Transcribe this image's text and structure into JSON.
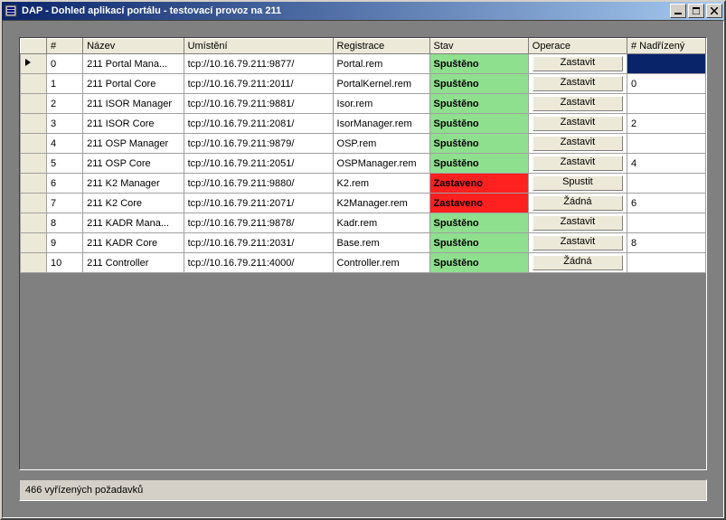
{
  "window": {
    "title": "DAP - Dohled aplikací portálu - testovací provoz na 211"
  },
  "headers": {
    "index": "#",
    "name": "Název",
    "location": "Umístění",
    "registration": "Registrace",
    "state": "Stav",
    "operation": "Operace",
    "supervisor": "# Nadřízený"
  },
  "state_labels": {
    "running": "Spuštěno",
    "stopped": "Zastaveno"
  },
  "rows": [
    {
      "idx": "0",
      "name": "211 Portal Mana...",
      "loc": "tcp://10.16.79.211:9877/",
      "reg": "Portal.rem",
      "state": "running",
      "op": "Zastavit",
      "sup": "",
      "selected": true
    },
    {
      "idx": "1",
      "name": "211 Portal Core",
      "loc": "tcp://10.16.79.211:2011/",
      "reg": "PortalKernel.rem",
      "state": "running",
      "op": "Zastavit",
      "sup": "0"
    },
    {
      "idx": "2",
      "name": "211 ISOR Manager",
      "loc": "tcp://10.16.79.211:9881/",
      "reg": "Isor.rem",
      "state": "running",
      "op": "Zastavit",
      "sup": ""
    },
    {
      "idx": "3",
      "name": "211 ISOR Core",
      "loc": "tcp://10.16.79.211:2081/",
      "reg": "IsorManager.rem",
      "state": "running",
      "op": "Zastavit",
      "sup": "2"
    },
    {
      "idx": "4",
      "name": "211 OSP Manager",
      "loc": "tcp://10.16.79.211:9879/",
      "reg": "OSP.rem",
      "state": "running",
      "op": "Zastavit",
      "sup": ""
    },
    {
      "idx": "5",
      "name": "211 OSP Core",
      "loc": "tcp://10.16.79.211:2051/",
      "reg": "OSPManager.rem",
      "state": "running",
      "op": "Zastavit",
      "sup": "4"
    },
    {
      "idx": "6",
      "name": "211 K2 Manager",
      "loc": "tcp://10.16.79.211:9880/",
      "reg": "K2.rem",
      "state": "stopped",
      "op": "Spustit",
      "sup": ""
    },
    {
      "idx": "7",
      "name": "211 K2 Core",
      "loc": "tcp://10.16.79.211:2071/",
      "reg": "K2Manager.rem",
      "state": "stopped",
      "op": "Žádná",
      "sup": "6"
    },
    {
      "idx": "8",
      "name": "211 KADR Mana...",
      "loc": "tcp://10.16.79.211:9878/",
      "reg": "Kadr.rem",
      "state": "running",
      "op": "Zastavit",
      "sup": ""
    },
    {
      "idx": "9",
      "name": "211 KADR Core",
      "loc": "tcp://10.16.79.211:2031/",
      "reg": "Base.rem",
      "state": "running",
      "op": "Zastavit",
      "sup": "8"
    },
    {
      "idx": "10",
      "name": "211 Controller",
      "loc": "tcp://10.16.79.211:4000/",
      "reg": "Controller.rem",
      "state": "running",
      "op": "Žádná",
      "sup": ""
    }
  ],
  "status": "466 vyřízených požadavků"
}
